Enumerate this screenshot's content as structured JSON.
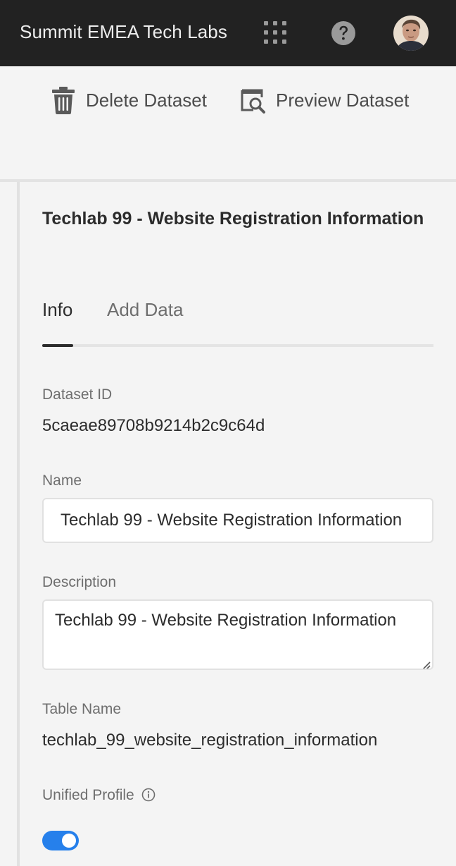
{
  "header": {
    "app_title": "Summit EMEA Tech Labs",
    "icons": [
      "apps-grid-icon",
      "help-icon",
      "user-avatar"
    ]
  },
  "actions": {
    "delete_label": "Delete Dataset",
    "preview_label": "Preview Dataset"
  },
  "panel": {
    "title": "Techlab 99 - Website Registration Information",
    "tabs": [
      {
        "label": "Info",
        "active": true
      },
      {
        "label": "Add Data",
        "active": false
      }
    ],
    "dataset_id": {
      "label": "Dataset ID",
      "value": "5caeae89708b9214b2c9c64d"
    },
    "name": {
      "label": "Name",
      "value": "Techlab 99 - Website Registration Information"
    },
    "description": {
      "label": "Description",
      "value": "Techlab 99 - Website Registration Information"
    },
    "table_name": {
      "label": "Table Name",
      "value": "techlab_99_website_registration_information"
    },
    "unified_profile": {
      "label": "Unified Profile",
      "enabled": true
    }
  },
  "colors": {
    "topbar": "#222222",
    "background": "#f4f4f4",
    "accent": "#2680eb",
    "text": "#2c2c2c",
    "muted_text": "#6e6e6e"
  }
}
